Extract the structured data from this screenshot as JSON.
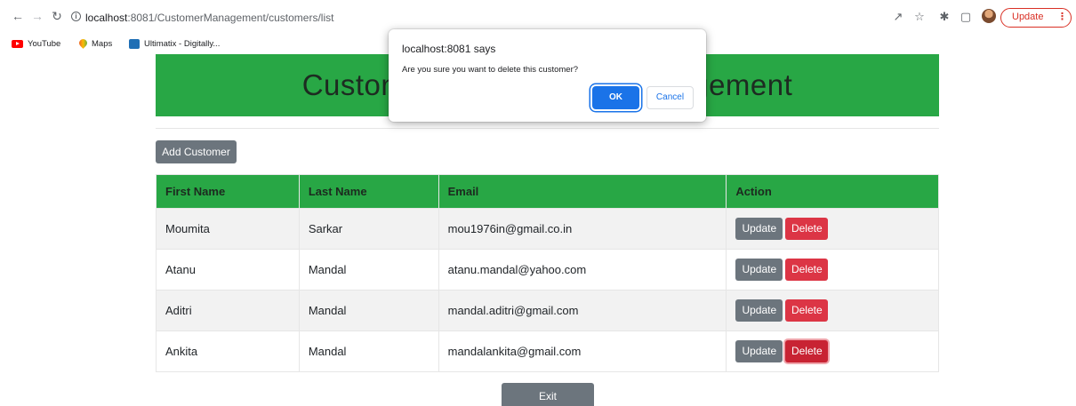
{
  "browser": {
    "url_host": "localhost",
    "url_path": ":8081/CustomerManagement/customers/list",
    "update_label": "Update",
    "bookmarks": [
      {
        "label": "YouTube"
      },
      {
        "label": "Maps"
      },
      {
        "label": "Ultimatix - Digitally..."
      }
    ]
  },
  "page": {
    "title": "Customer Relationship Management",
    "add_button": "Add Customer",
    "exit_button": "Exit",
    "table": {
      "headers": [
        "First Name",
        "Last Name",
        "Email",
        "Action"
      ],
      "rows": [
        {
          "first": "Moumita",
          "last": "Sarkar",
          "email": "mou1976in@gmail.co.in"
        },
        {
          "first": "Atanu",
          "last": "Mandal",
          "email": "atanu.mandal@yahoo.com"
        },
        {
          "first": "Aditri",
          "last": "Mandal",
          "email": "mandal.aditri@gmail.com"
        },
        {
          "first": "Ankita",
          "last": "Mandal",
          "email": "mandalankita@gmail.com"
        }
      ],
      "update_label": "Update",
      "delete_label": "Delete"
    }
  },
  "dialog": {
    "title": "localhost:8081 says",
    "message": "Are you sure you want to delete this customer?",
    "ok": "OK",
    "cancel": "Cancel"
  },
  "colors": {
    "header_green": "#28a745",
    "secondary": "#6c757d",
    "danger": "#dc3545",
    "dialog_primary": "#1a73e8"
  }
}
